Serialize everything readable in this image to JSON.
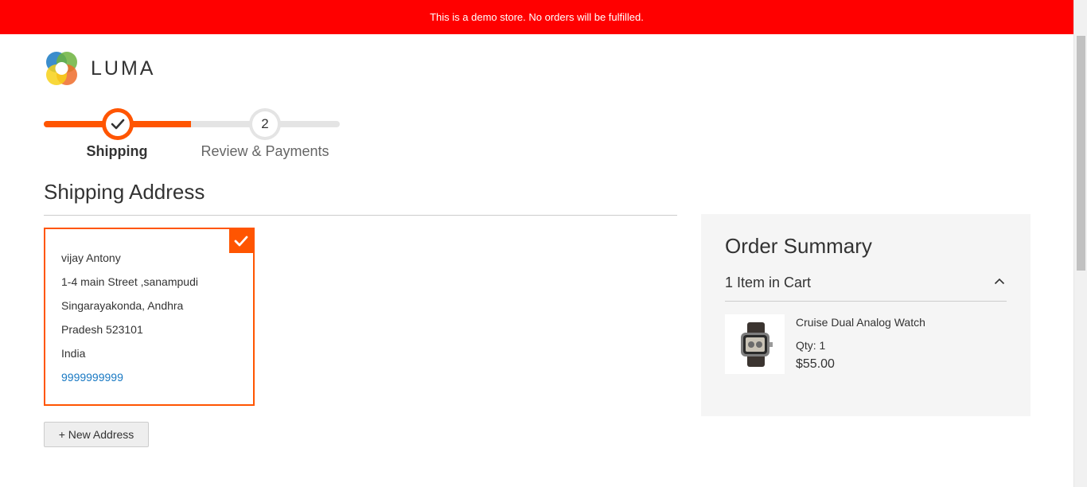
{
  "notice": {
    "text": "This is a demo store. No orders will be fulfilled."
  },
  "brand": {
    "name": "LUMA",
    "accent": "#ff5501",
    "notice_bg": "#ff0000",
    "link": "#1979c3"
  },
  "progress": {
    "steps": [
      {
        "number": "1",
        "label": "Shipping",
        "state": "complete"
      },
      {
        "number": "2",
        "label": "Review & Payments",
        "state": "pending"
      }
    ]
  },
  "shipping": {
    "title": "Shipping Address",
    "address": {
      "name": "vijay Antony",
      "street": "1-4 main Street ,sanampudi",
      "city_line": "Singarayakonda, Andhra",
      "region_line": "Pradesh 523101",
      "country": "India",
      "phone": "9999999999"
    },
    "new_address_label": "+ New Address"
  },
  "summary": {
    "title": "Order Summary",
    "cart_count": "1 Item in Cart",
    "items": [
      {
        "name": "Cruise Dual Analog Watch",
        "qty_label": "Qty: 1",
        "price": "$55.00"
      }
    ]
  }
}
